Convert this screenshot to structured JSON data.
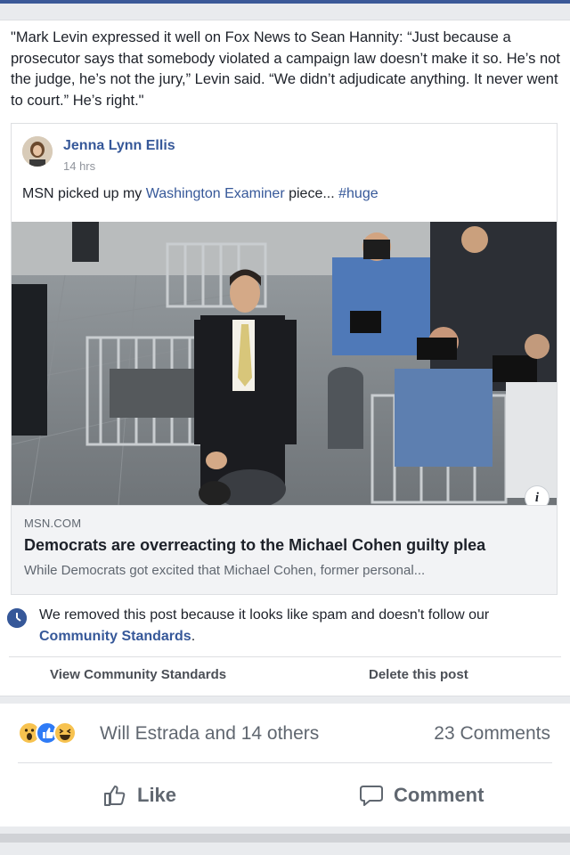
{
  "post": {
    "text": "\"Mark Levin expressed it well on Fox News to Sean Hannity: “Just because a prosecutor says that somebody violated a campaign law doesn’t make it so. He’s not the judge, he’s not the jury,” Levin said. “We didn’t adjudicate anything. It never went to court.” He’s right.\""
  },
  "shared_post": {
    "author": "Jenna Lynn Ellis",
    "time": "14 hrs",
    "text_prefix": "MSN picked up my ",
    "text_link": "Washington Examiner",
    "text_middle": " piece... ",
    "hashtag": "#huge"
  },
  "link_preview": {
    "domain": "MSN.COM",
    "headline": "Democrats are overreacting to the Michael Cohen guilty plea",
    "snippet": "While Democrats got excited that Michael Cohen, former personal...",
    "info_glyph": "i"
  },
  "removal_notice": {
    "text": "We removed this post because it looks like spam and doesn't follow our ",
    "link": "Community Standards",
    "period": ".",
    "view_button": "View Community Standards",
    "delete_button": "Delete this post"
  },
  "engagement": {
    "reactions": [
      "wow",
      "like",
      "haha"
    ],
    "names": "Will Estrada and 14 others",
    "comments": "23 Comments",
    "like_label": "Like",
    "comment_label": "Comment"
  },
  "colors": {
    "link": "#365899",
    "brand": "#3b5998",
    "muted": "#606770"
  }
}
